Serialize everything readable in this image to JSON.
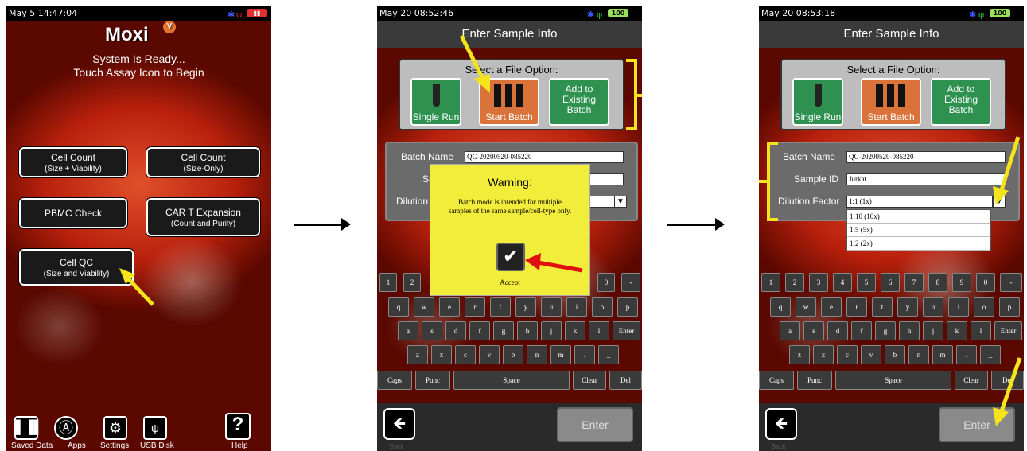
{
  "screen1": {
    "status_time": "May 5 14:47:04",
    "logo": "Moxi",
    "logo_badge": "V",
    "message_line1": "System Is Ready...",
    "message_line2": "Touch Assay Icon to Begin",
    "assays": [
      {
        "title": "Cell Count",
        "sub": "(Size + Viability)"
      },
      {
        "title": "Cell Count",
        "sub": "(Size-Only)"
      },
      {
        "title": "PBMC Check",
        "sub": ""
      },
      {
        "title": "CAR T Expansion",
        "sub": "(Count and Purity)"
      },
      {
        "title": "Cell QC",
        "sub": "(Size and Viability)"
      }
    ],
    "bottom": {
      "saved": "Saved Data",
      "apps": "Apps",
      "settings": "Settings",
      "usb": "USB Disk",
      "help": "Help",
      "help_glyph": "?"
    }
  },
  "screen2": {
    "status_time": "May 20 08:52:46",
    "title": "Enter Sample Info",
    "file_prompt": "Select a File Option:",
    "single_run": "Single Run",
    "start_batch": "Start Batch",
    "add_existing": "Add to Existing Batch",
    "batch_label": "Batch Name",
    "batch_value": "QC-20200520-085220",
    "sample_label_partial": "Sa",
    "dilution_label_partial": "Dilution",
    "warning_title": "Warning:",
    "warning_body": "Batch mode is intended for multiple samples of the same sample/cell-type only.",
    "accept": "Accept",
    "enter": "Enter",
    "back": "Back"
  },
  "screen3": {
    "status_time": "May 20 08:53:18",
    "title": "Enter Sample Info",
    "file_prompt": "Select a File Option:",
    "single_run": "Single Run",
    "start_batch": "Start Batch",
    "add_existing": "Add to Existing Batch",
    "batch_label": "Batch Name",
    "batch_value": "QC-20200520-085220",
    "sample_label": "Sample ID",
    "sample_value": "Jurkat",
    "dilution_label": "Dilution Factor",
    "dilution_selected": "1:1 (1x)",
    "dilution_options": [
      "1:10 (10x)",
      "1:5 (5x)",
      "1:2 (2x)"
    ],
    "enter": "Enter",
    "back": "Back"
  },
  "keyboard": {
    "row1": [
      "1",
      "2",
      "3",
      "4",
      "5",
      "6",
      "7",
      "8",
      "9",
      "0",
      "-"
    ],
    "row2": [
      "q",
      "w",
      "e",
      "r",
      "t",
      "y",
      "u",
      "i",
      "o",
      "p"
    ],
    "row3": [
      "a",
      "s",
      "d",
      "f",
      "g",
      "h",
      "j",
      "k",
      "l",
      "Enter"
    ],
    "row4": [
      "z",
      "x",
      "c",
      "v",
      "b",
      "n",
      "m",
      ".",
      "_"
    ],
    "row5": [
      "Caps",
      "Punc",
      "Space",
      "Clear",
      "Del"
    ]
  },
  "battery_label": "100",
  "colors": {
    "highlight": "#f5e41c",
    "warning_bg": "#f2ec3a",
    "green_button": "#2e9150",
    "orange_button": "#d9733a",
    "pointer_red": "#e01010"
  }
}
